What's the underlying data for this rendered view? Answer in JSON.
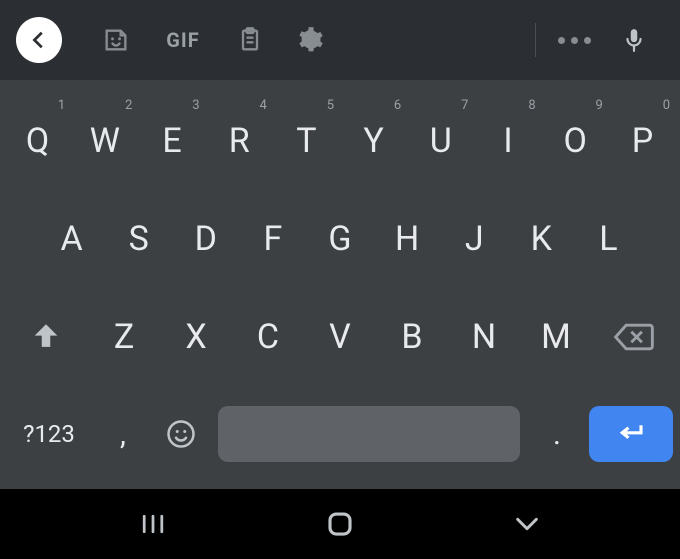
{
  "toolbar": {
    "gif_label": "GIF"
  },
  "keyboard": {
    "row1": [
      {
        "letter": "Q",
        "sup": "1"
      },
      {
        "letter": "W",
        "sup": "2"
      },
      {
        "letter": "E",
        "sup": "3"
      },
      {
        "letter": "R",
        "sup": "4"
      },
      {
        "letter": "T",
        "sup": "5"
      },
      {
        "letter": "Y",
        "sup": "6"
      },
      {
        "letter": "U",
        "sup": "7"
      },
      {
        "letter": "I",
        "sup": "8"
      },
      {
        "letter": "O",
        "sup": "9"
      },
      {
        "letter": "P",
        "sup": "0"
      }
    ],
    "row2": [
      {
        "letter": "A"
      },
      {
        "letter": "S"
      },
      {
        "letter": "D"
      },
      {
        "letter": "F"
      },
      {
        "letter": "G"
      },
      {
        "letter": "H"
      },
      {
        "letter": "J"
      },
      {
        "letter": "K"
      },
      {
        "letter": "L"
      }
    ],
    "row3": [
      {
        "letter": "Z"
      },
      {
        "letter": "X"
      },
      {
        "letter": "C"
      },
      {
        "letter": "V"
      },
      {
        "letter": "B"
      },
      {
        "letter": "N"
      },
      {
        "letter": "M"
      }
    ],
    "symbols_label": "?123",
    "comma_label": ",",
    "period_label": "."
  }
}
